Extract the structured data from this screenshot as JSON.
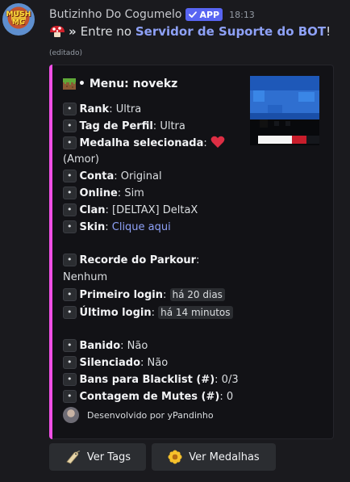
{
  "bot": {
    "avatar_text": "MUSH MC",
    "username": "Butizinho Do Cogumelo",
    "badge": "APP",
    "timestamp": "18:13"
  },
  "message": {
    "arrow": "»",
    "prefix": "Entre no",
    "link_text": "Servidor de Suporte do BOT",
    "suffix": "!",
    "edited": "(editado)"
  },
  "embed": {
    "accent_color": "#f14fe6",
    "title": "• Menu: novekz",
    "bullet": "•",
    "fields": {
      "rank_label": "Rank",
      "rank_value": "Ultra",
      "tag_label": "Tag de Perfil",
      "tag_value": "Ultra",
      "medal_label": "Medalha selecionada",
      "medal_value": "(Amor)",
      "account_label": "Conta",
      "account_value": "Original",
      "online_label": "Online",
      "online_value": "Sim",
      "clan_label": "Clan",
      "clan_value": "[DELTAX] DeltaX",
      "skin_label": "Skin",
      "skin_value": "Clique aqui",
      "parkour_label": "Recorde do Parkour",
      "parkour_value": "Nenhum",
      "first_login_label": "Primeiro login",
      "first_login_value": "há 20 dias",
      "last_login_label": "Último login",
      "last_login_value": "há 14 minutos",
      "banned_label": "Banido",
      "banned_value": "Não",
      "muted_label": "Silenciado",
      "muted_value": "Não",
      "blacklist_label": "Bans para Blacklist (#)",
      "blacklist_value": "0/3",
      "mutes_label": "Contagem de Mutes (#)",
      "mutes_value": "0"
    },
    "footer_text": "Desenvolvido por yPandinho"
  },
  "buttons": {
    "tags_label": "Ver Tags",
    "medals_label": "Ver Medalhas"
  },
  "icons": {
    "mushroom": "mushroom-icon",
    "grass_block": "grass-block-icon",
    "heart": "heart-icon",
    "tag": "tag-icon",
    "medal": "flower-medal-icon",
    "check": "check-icon"
  }
}
